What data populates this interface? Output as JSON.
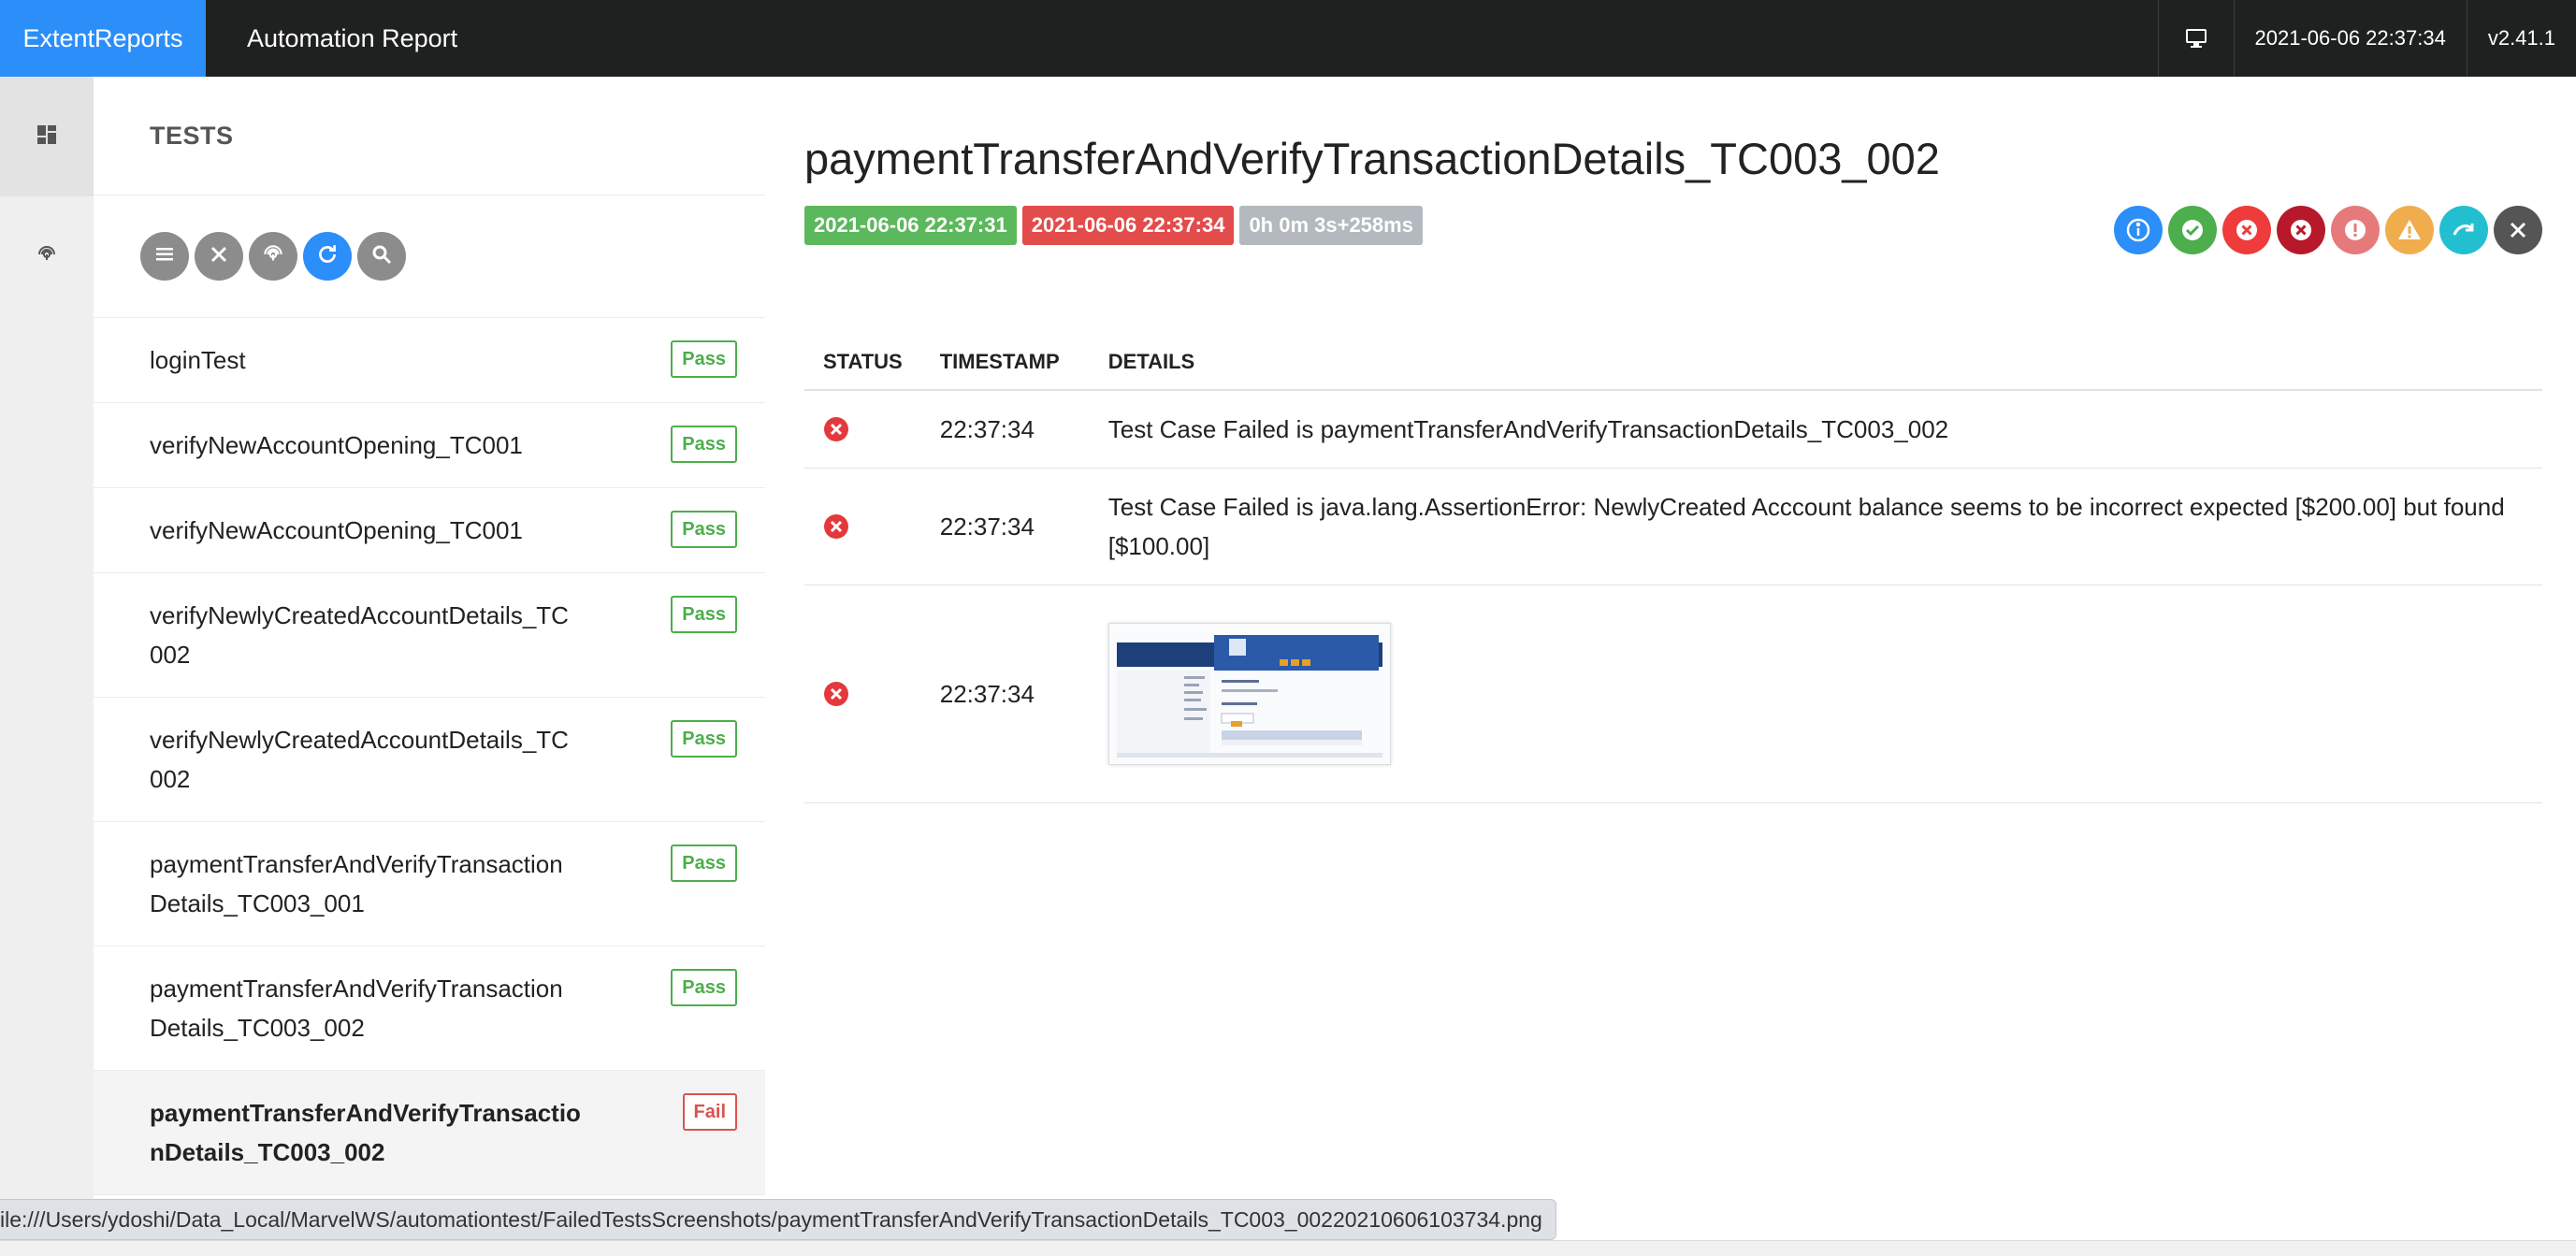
{
  "topbar": {
    "brand": "ExtentReports",
    "report_name": "Automation Report",
    "datetime": "2021-06-06 22:37:34",
    "version": "v2.41.1"
  },
  "side_nav": {
    "items": [
      {
        "icon": "dashboard-icon",
        "active": true
      },
      {
        "icon": "fingerprint-icon",
        "active": false
      }
    ]
  },
  "tests_panel": {
    "title": "TESTS",
    "filters": [
      "list-icon",
      "close-icon",
      "fingerprint-icon",
      "refresh-icon",
      "search-icon"
    ],
    "items": [
      {
        "name": "loginTest",
        "status": "Pass"
      },
      {
        "name": "verifyNewAccountOpening_TC001",
        "status": "Pass"
      },
      {
        "name": "verifyNewAccountOpening_TC001",
        "status": "Pass"
      },
      {
        "name": "verifyNewlyCreatedAccountDetails_TC\n002",
        "status": "Pass"
      },
      {
        "name": "verifyNewlyCreatedAccountDetails_TC\n002",
        "status": "Pass"
      },
      {
        "name": "paymentTransferAndVerifyTransaction\nDetails_TC003_001",
        "status": "Pass"
      },
      {
        "name": "paymentTransferAndVerifyTransaction\nDetails_TC003_002",
        "status": "Pass"
      },
      {
        "name": "paymentTransferAndVerifyTransactio\nnDetails_TC003_002",
        "status": "Fail"
      }
    ]
  },
  "detail": {
    "title": "paymentTransferAndVerifyTransactionDetails_TC003_002",
    "start_time": "2021-06-06 22:37:31",
    "end_time": "2021-06-06 22:37:34",
    "duration": "0h 0m 3s+258ms",
    "status_icons": [
      {
        "name": "info-icon",
        "color": "#2c8ef8"
      },
      {
        "name": "pass-icon",
        "color": "#4cae4c"
      },
      {
        "name": "fail-icon",
        "color": "#ef3b3b"
      },
      {
        "name": "fatal-icon",
        "color": "#b8192a"
      },
      {
        "name": "error-icon",
        "color": "#e67a7a"
      },
      {
        "name": "warning-icon",
        "color": "#f0ad4e"
      },
      {
        "name": "skip-icon",
        "color": "#22bfd1"
      },
      {
        "name": "clear-icon",
        "color": "#555555"
      }
    ],
    "table": {
      "headers": {
        "status": "STATUS",
        "timestamp": "TIMESTAMP",
        "details": "DETAILS"
      },
      "rows": [
        {
          "timestamp": "22:37:34",
          "details": "Test Case Failed is paymentTransferAndVerifyTransactionDetails_TC003_002"
        },
        {
          "timestamp": "22:37:34",
          "details": "Test Case Failed is java.lang.AssertionError: NewlyCreated Acccount balance seems to be incorrect expected [$200.00] but found [$100.00]"
        },
        {
          "timestamp": "22:37:34",
          "details": ""
        }
      ]
    }
  },
  "status_url": "ile:///Users/ydoshi/Data_Local/MarvelWS/automationtest/FailedTestsScreenshots/paymentTransferAndVerifyTransactionDetails_TC003_00220210606103734.png",
  "colors": {
    "brand": "#2c8ef8",
    "topbar": "#1f2121",
    "pass": "#4cae4c",
    "fail": "#d9534f"
  }
}
